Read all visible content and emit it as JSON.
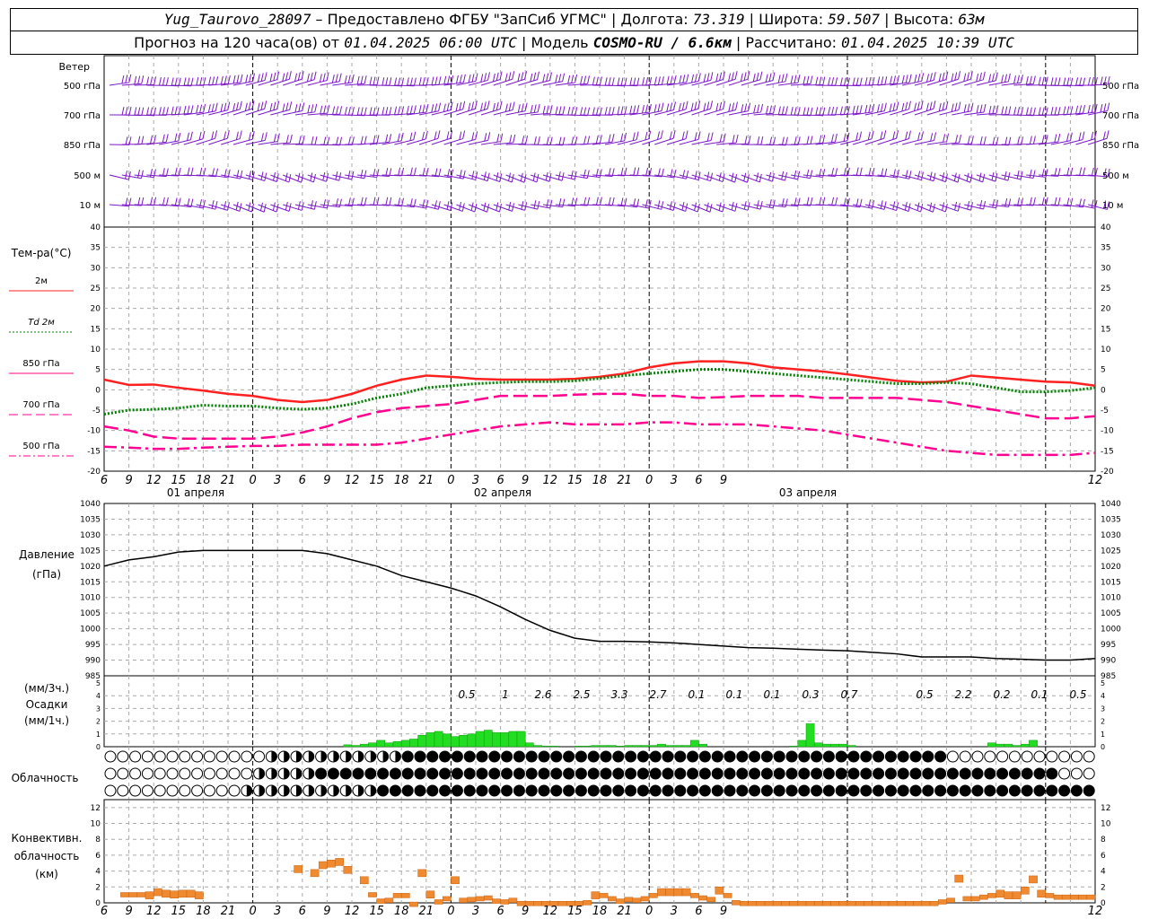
{
  "header": {
    "station": "Yug_Taurovo_28097",
    "provider": "Предоставлено ФГБУ \"ЗапСиб УГМС\"",
    "lon_label": "Долгота:",
    "lon": "73.319",
    "lat_label": "Широта:",
    "lat": "59.507",
    "alt_label": "Высота:",
    "alt": "63м",
    "forecast_label": "Прогноз на 120 часа(ов) от",
    "forecast_start": "01.04.2025 06:00 UTC",
    "model_label": "Модель",
    "model": "COSMO-RU / 6.6км",
    "calc_label": "Рассчитано:",
    "calc_time": "01.04.2025 10:39 UTC"
  },
  "wind_panel": {
    "title": "Ветер",
    "levels": [
      "500 гПа",
      "700 гПа",
      "850 гПа",
      "500 м",
      "10 м"
    ],
    "color": "#7b18c8"
  },
  "temp_panel": {
    "title": "Тем-ра(°C)",
    "legend": [
      {
        "label": "2м",
        "color": "#ff2020",
        "style": "solid"
      },
      {
        "label": "Td  2м",
        "color": "#008000",
        "style": "dotted"
      },
      {
        "label": "850 гПа",
        "color": "#ff0090",
        "style": "solid"
      },
      {
        "label": "700 гПа",
        "color": "#ff0090",
        "style": "dashed"
      },
      {
        "label": "500 гПа",
        "color": "#ff0090",
        "style": "dashdot"
      }
    ],
    "yticks": [
      "40",
      "35",
      "30",
      "25",
      "20",
      "15",
      "10",
      "5",
      "0",
      "-5",
      "-10",
      "-15",
      "-20"
    ],
    "date_labels": [
      "01 апреля",
      "02 апреля",
      "03 апреля"
    ]
  },
  "pressure_panel": {
    "title1": "Давление",
    "title2": "(гПа)",
    "yticks": [
      "1040",
      "1035",
      "1030",
      "1025",
      "1020",
      "1015",
      "1010",
      "1005",
      "1000",
      "995",
      "990",
      "985"
    ]
  },
  "precip_panel": {
    "title1": "(мм/3ч.)",
    "title2": "Осадки",
    "title3": "(мм/1ч.)",
    "yticks": [
      "5",
      "4",
      "3",
      "2",
      "1",
      "0"
    ],
    "totals": [
      "0.5",
      "1",
      "2.6",
      "2.5",
      "3.3",
      "2.7",
      "0.1",
      "0.1",
      "0.1",
      "0.3",
      "0.7",
      "0.5",
      "2.2",
      "0.2",
      "0.1",
      "0.5"
    ]
  },
  "cloud_panel": {
    "title": "Облачность"
  },
  "conv_panel": {
    "title1": "Конвективн.",
    "title2": "облачность",
    "title3": "(км)",
    "yticks": [
      "12",
      "10",
      "8",
      "6",
      "4",
      "2",
      "0"
    ]
  },
  "time_axis": {
    "ticks": [
      "6",
      "9",
      "12",
      "15",
      "18",
      "21",
      "0",
      "3",
      "6",
      "9",
      "12",
      "15",
      "18",
      "21",
      "0",
      "3",
      "6",
      "9",
      "12",
      "15",
      "18",
      "21",
      "0",
      "3",
      "6",
      "9",
      "12"
    ]
  },
  "chart_data": [
    {
      "type": "line",
      "title": "Тем-ра(°C)",
      "x_hours": [
        0,
        3,
        6,
        9,
        12,
        15,
        18,
        21,
        24,
        27,
        30,
        33,
        36,
        39,
        42,
        45,
        48,
        51,
        54,
        57,
        60,
        63,
        66,
        69,
        72,
        75,
        78,
        81,
        84,
        87,
        90,
        93,
        96,
        99,
        102,
        105,
        108,
        111,
        114,
        117,
        120
      ],
      "ylim": [
        -20,
        40
      ],
      "series": [
        {
          "name": "2м",
          "values": [
            2.5,
            1.2,
            1.3,
            0.5,
            -0.2,
            -1.0,
            -1.5,
            -2.5,
            -3.0,
            -2.5,
            -1.0,
            1.0,
            2.5,
            3.5,
            3.2,
            2.7,
            2.5,
            2.5,
            2.5,
            2.7,
            3.2,
            4.0,
            5.5,
            6.5,
            7.0,
            7.0,
            6.5,
            5.5,
            5.0,
            4.5,
            3.8,
            3.0,
            2.2,
            1.8,
            2.0,
            3.5,
            3.0,
            2.5,
            2.0,
            1.8,
            1.0
          ]
        },
        {
          "name": "Td  2м",
          "values": [
            -6.0,
            -5.0,
            -4.8,
            -4.5,
            -3.8,
            -4.0,
            -4.0,
            -4.5,
            -4.8,
            -4.5,
            -3.5,
            -2.0,
            -1.0,
            0.5,
            1.0,
            1.5,
            1.8,
            2.0,
            2.0,
            2.2,
            2.8,
            3.5,
            4.0,
            4.5,
            5.0,
            5.0,
            4.5,
            4.0,
            3.5,
            3.0,
            2.5,
            2.0,
            1.5,
            1.5,
            1.8,
            1.5,
            0.5,
            -0.5,
            -0.5,
            -0.2,
            0.5
          ]
        },
        {
          "name": "700 гПа",
          "values": [
            -9.0,
            -10.0,
            -11.5,
            -12.0,
            -12.0,
            -12.0,
            -12.0,
            -11.5,
            -10.5,
            -9.0,
            -7.0,
            -5.5,
            -4.5,
            -4.0,
            -3.5,
            -2.5,
            -1.5,
            -1.5,
            -1.5,
            -1.2,
            -1.0,
            -1.0,
            -1.5,
            -1.5,
            -2.0,
            -1.8,
            -1.5,
            -1.5,
            -1.5,
            -2.0,
            -2.0,
            -2.0,
            -2.0,
            -2.5,
            -3.0,
            -4.0,
            -5.0,
            -6.0,
            -7.0,
            -7.0,
            -6.5
          ]
        },
        {
          "name": "500 гПа",
          "values": [
            -14.0,
            -14.2,
            -14.5,
            -14.5,
            -14.2,
            -14.0,
            -13.8,
            -13.8,
            -13.5,
            -13.5,
            -13.5,
            -13.5,
            -13.0,
            -12.0,
            -11.0,
            -10.0,
            -9.0,
            -8.5,
            -8.0,
            -8.5,
            -8.5,
            -8.5,
            -8.0,
            -8.0,
            -8.5,
            -8.5,
            -8.5,
            -9.0,
            -9.5,
            -10.0,
            -11.0,
            -12.0,
            -13.0,
            -14.0,
            -15.0,
            -15.5,
            -16.0,
            -16.0,
            -16.0,
            -16.0,
            -15.5
          ]
        }
      ]
    },
    {
      "type": "line",
      "title": "Давление",
      "x_hours": [
        0,
        3,
        6,
        9,
        12,
        15,
        18,
        21,
        24,
        27,
        30,
        33,
        36,
        39,
        42,
        45,
        48,
        51,
        54,
        57,
        60,
        63,
        66,
        69,
        72,
        75,
        78,
        81,
        84,
        87,
        90,
        93,
        96,
        99,
        102,
        105,
        108,
        111,
        114,
        117,
        120
      ],
      "ylim": [
        985,
        1040
      ],
      "series": [
        {
          "name": "(гПа)",
          "values": [
            1020,
            1022,
            1023,
            1024.5,
            1025,
            1025,
            1025,
            1025,
            1025,
            1024,
            1022,
            1020,
            1017,
            1015,
            1013,
            1010.5,
            1007,
            1003,
            999.5,
            997,
            996,
            996,
            995.8,
            995.5,
            995,
            994.5,
            994,
            993.8,
            993.5,
            993.2,
            993,
            992.5,
            992,
            991,
            991,
            991,
            990.5,
            990.3,
            990,
            990,
            990.5
          ]
        }
      ]
    },
    {
      "type": "bar",
      "title": "Осадки",
      "x_hours": [
        30,
        31,
        32,
        33,
        34,
        35,
        36,
        37,
        38,
        39,
        40,
        41,
        42,
        43,
        44,
        45,
        46,
        47,
        48,
        49,
        50,
        51,
        52,
        53,
        54,
        55,
        56,
        57,
        58,
        59,
        60,
        61,
        62,
        63,
        64,
        65,
        66,
        67,
        68,
        69,
        70,
        71,
        72,
        73,
        74,
        75,
        76,
        77,
        78,
        79,
        80,
        81,
        82,
        83,
        84,
        85,
        86,
        87,
        88,
        89,
        90,
        91,
        92,
        93,
        94,
        95,
        96,
        97,
        98,
        99,
        100,
        101,
        102,
        103,
        104,
        105,
        106,
        107,
        108,
        109,
        110,
        111,
        112,
        113,
        114,
        115,
        116,
        117,
        118,
        119,
        120
      ],
      "ylim": [
        0,
        5
      ],
      "series": [
        {
          "name": "(мм/1ч.)",
          "values": [
            0.15,
            0.1,
            0.2,
            0.3,
            0.5,
            0.3,
            0.4,
            0.5,
            0.6,
            0.9,
            1.1,
            1.2,
            1.0,
            0.8,
            0.9,
            1.0,
            1.2,
            1.3,
            1.1,
            1.1,
            1.2,
            1.2,
            0.3,
            0.1,
            0.05,
            0.05,
            0,
            0,
            0.05,
            0.05,
            0.1,
            0.1,
            0.1,
            0.05,
            0.1,
            0.1,
            0.1,
            0.1,
            0.2,
            0.1,
            0.1,
            0.1,
            0.5,
            0.2,
            0,
            0,
            0,
            0,
            0,
            0,
            0,
            0,
            0,
            0,
            0.05,
            0.5,
            1.8,
            0.3,
            0.2,
            0.2,
            0.2,
            0.1,
            0,
            0,
            0,
            0,
            0,
            0,
            0,
            0,
            0,
            0,
            0,
            0,
            0,
            0,
            0,
            0,
            0.3,
            0.2,
            0.2,
            0.1,
            0.2,
            0.5,
            0,
            0,
            0,
            0,
            0,
            0,
            0
          ]
        }
      ]
    },
    {
      "type": "bar",
      "title": "Конвективн. облачность",
      "x_hours": [
        3,
        4,
        5,
        6,
        7,
        8,
        9,
        10,
        11,
        12,
        24,
        26,
        27,
        28,
        29,
        30,
        32,
        33,
        34,
        35,
        36,
        37,
        38,
        39,
        40,
        41,
        42,
        43,
        44,
        45,
        46,
        47,
        48,
        49,
        50,
        51,
        52,
        53,
        54,
        55,
        56,
        57,
        58,
        59,
        60,
        61,
        62,
        63,
        64,
        65,
        66,
        67,
        68,
        69,
        70,
        71,
        72,
        73,
        74,
        75,
        76,
        77,
        78,
        79,
        80,
        81,
        82,
        83,
        84,
        85,
        86,
        87,
        88,
        89,
        90,
        91,
        92,
        93,
        94,
        95,
        96,
        97,
        98,
        99,
        100,
        101,
        102,
        103,
        104,
        105,
        106,
        107,
        108,
        109,
        110,
        111,
        112,
        113,
        114,
        115,
        116,
        117,
        118,
        119,
        120
      ],
      "ylim": [
        0,
        12
      ],
      "series": [
        {
          "name": "(км)",
          "values": [
            1.3,
            1.3,
            1.3,
            1.4,
            1.8,
            1.6,
            1.5,
            1.6,
            1.6,
            1.4,
            4.7,
            4.2,
            5.2,
            5.4,
            5.6,
            4.6,
            3.3,
            1.3,
            0.5,
            0.6,
            1.2,
            1.2,
            0.1,
            4.2,
            1.5,
            0.4,
            0.8,
            3.3,
            0.6,
            0.7,
            0.8,
            0.9,
            0.5,
            0.4,
            0.6,
            0.2,
            0.2,
            0.2,
            0.2,
            0.2,
            0.2,
            0.2,
            0.2,
            0.3,
            1.4,
            1.2,
            0.8,
            0.5,
            0.7,
            0.6,
            0.8,
            1.2,
            1.8,
            1.8,
            1.8,
            1.8,
            1.2,
            0.9,
            0.7,
            2.0,
            1.2,
            0.3,
            0.2,
            0.2,
            0.2,
            0.2,
            0.2,
            0.2,
            0.2,
            0.2,
            0.2,
            0.2,
            0.2,
            0.2,
            0.2,
            0.2,
            0.2,
            0.2,
            0.2,
            0.2,
            0.2,
            0.2,
            0.2,
            0.2,
            0.2,
            0.2,
            0.4,
            0.6,
            3.5,
            0.8,
            0.8,
            1.0,
            1.2,
            1.6,
            1.4,
            1.4,
            2.0,
            3.4,
            1.6,
            1.2,
            1.0,
            1.0,
            1.0,
            1.0,
            1.0
          ]
        }
      ]
    }
  ]
}
